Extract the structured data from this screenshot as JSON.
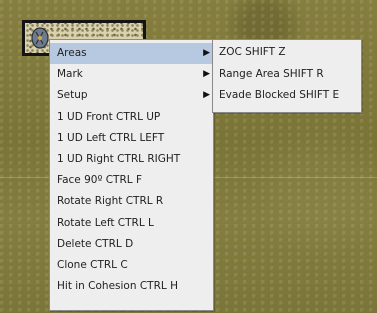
{
  "board": {
    "counter_icon": "unit-counter-icon"
  },
  "context_menu": {
    "items": [
      {
        "label": "Areas",
        "has_submenu": true,
        "selected": true
      },
      {
        "label": "Mark",
        "has_submenu": true
      },
      {
        "label": "Setup",
        "has_submenu": true
      },
      {
        "label": "1 UD Front  CTRL UP"
      },
      {
        "label": "1 UD Left  CTRL LEFT"
      },
      {
        "label": "1 UD Right  CTRL RIGHT"
      },
      {
        "label": "Face 90º  CTRL F"
      },
      {
        "label": "Rotate Right  CTRL R"
      },
      {
        "label": "Rotate Left  CTRL L"
      },
      {
        "label": "Delete  CTRL D"
      },
      {
        "label": "Clone  CTRL C"
      },
      {
        "label": "Hit in Cohesion  CTRL H"
      }
    ],
    "submenu_arrow_icon": "submenu-arrow-icon",
    "submenu_arrow_glyph": "▶"
  },
  "areas_submenu": {
    "items": [
      {
        "label": "ZOC  SHIFT Z"
      },
      {
        "label": "Range Area  SHIFT R"
      },
      {
        "label": "Evade Blocked  SHIFT E"
      }
    ]
  },
  "colors": {
    "menu_background": "#eeeeee",
    "selection_highlight": "#b7c8e1",
    "board_base": "#7f7a3a"
  }
}
